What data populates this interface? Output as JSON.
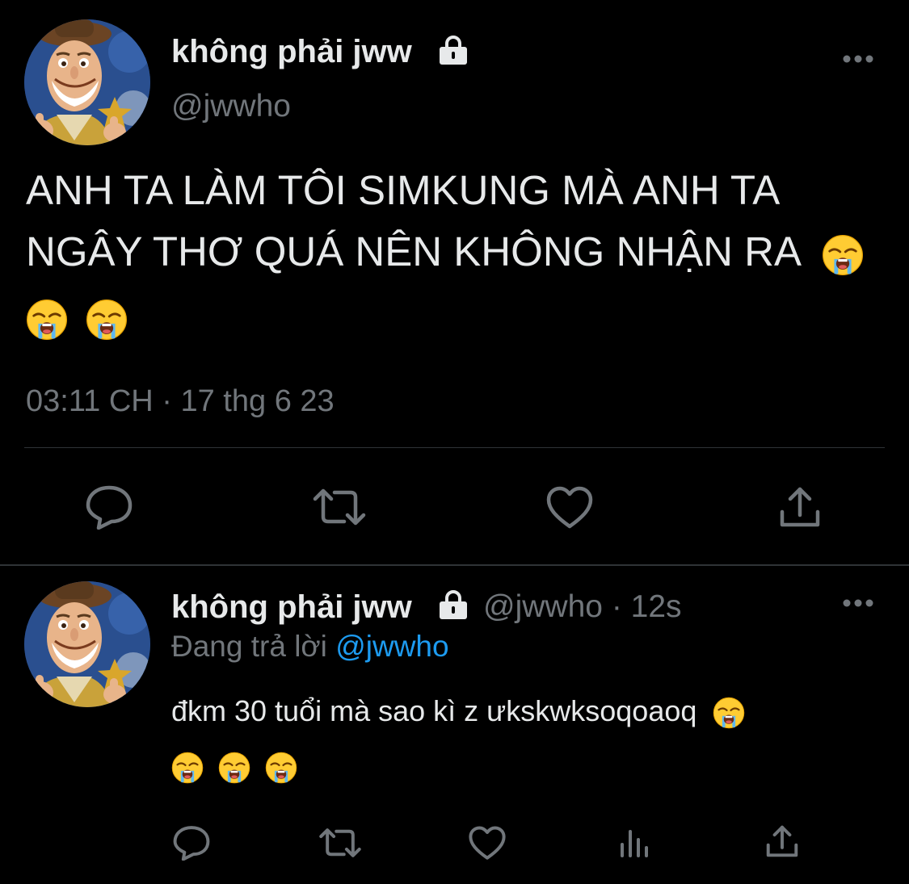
{
  "main_tweet": {
    "display_name": "không phải jww",
    "handle": "@jwwho",
    "text_line_1": "ANH TA LÀM TÔI SIMKUNG MÀ ANH TA",
    "text_line_2": "NGÂY THƠ QUÁ NÊN KHÔNG NHẬN RA",
    "timestamp": "03:11 CH · 17 thg 6 23",
    "emoji": "loudly-crying-face",
    "emoji_count": 3
  },
  "reply_tweet": {
    "display_name": "không phải jww",
    "handle": "@jwwho",
    "separator": "·",
    "time_ago": "12s",
    "replying_label": "Đang trả lời",
    "replying_to": "@jwwho",
    "text": "đkm 30 tuổi mà sao kì z ưkskwksoqoaoq",
    "emoji": "loudly-crying-face",
    "emoji_count": 4
  },
  "icons": {
    "lock": "lock-icon",
    "more": "more-icon",
    "reply": "reply-icon",
    "retweet": "retweet-icon",
    "like": "heart-icon",
    "views": "analytics-icon",
    "share": "share-icon"
  },
  "colors": {
    "background": "#000000",
    "primary_text": "#e7e9ea",
    "secondary_text": "#71767b",
    "link": "#1d9bf0",
    "divider": "#2f3336"
  }
}
